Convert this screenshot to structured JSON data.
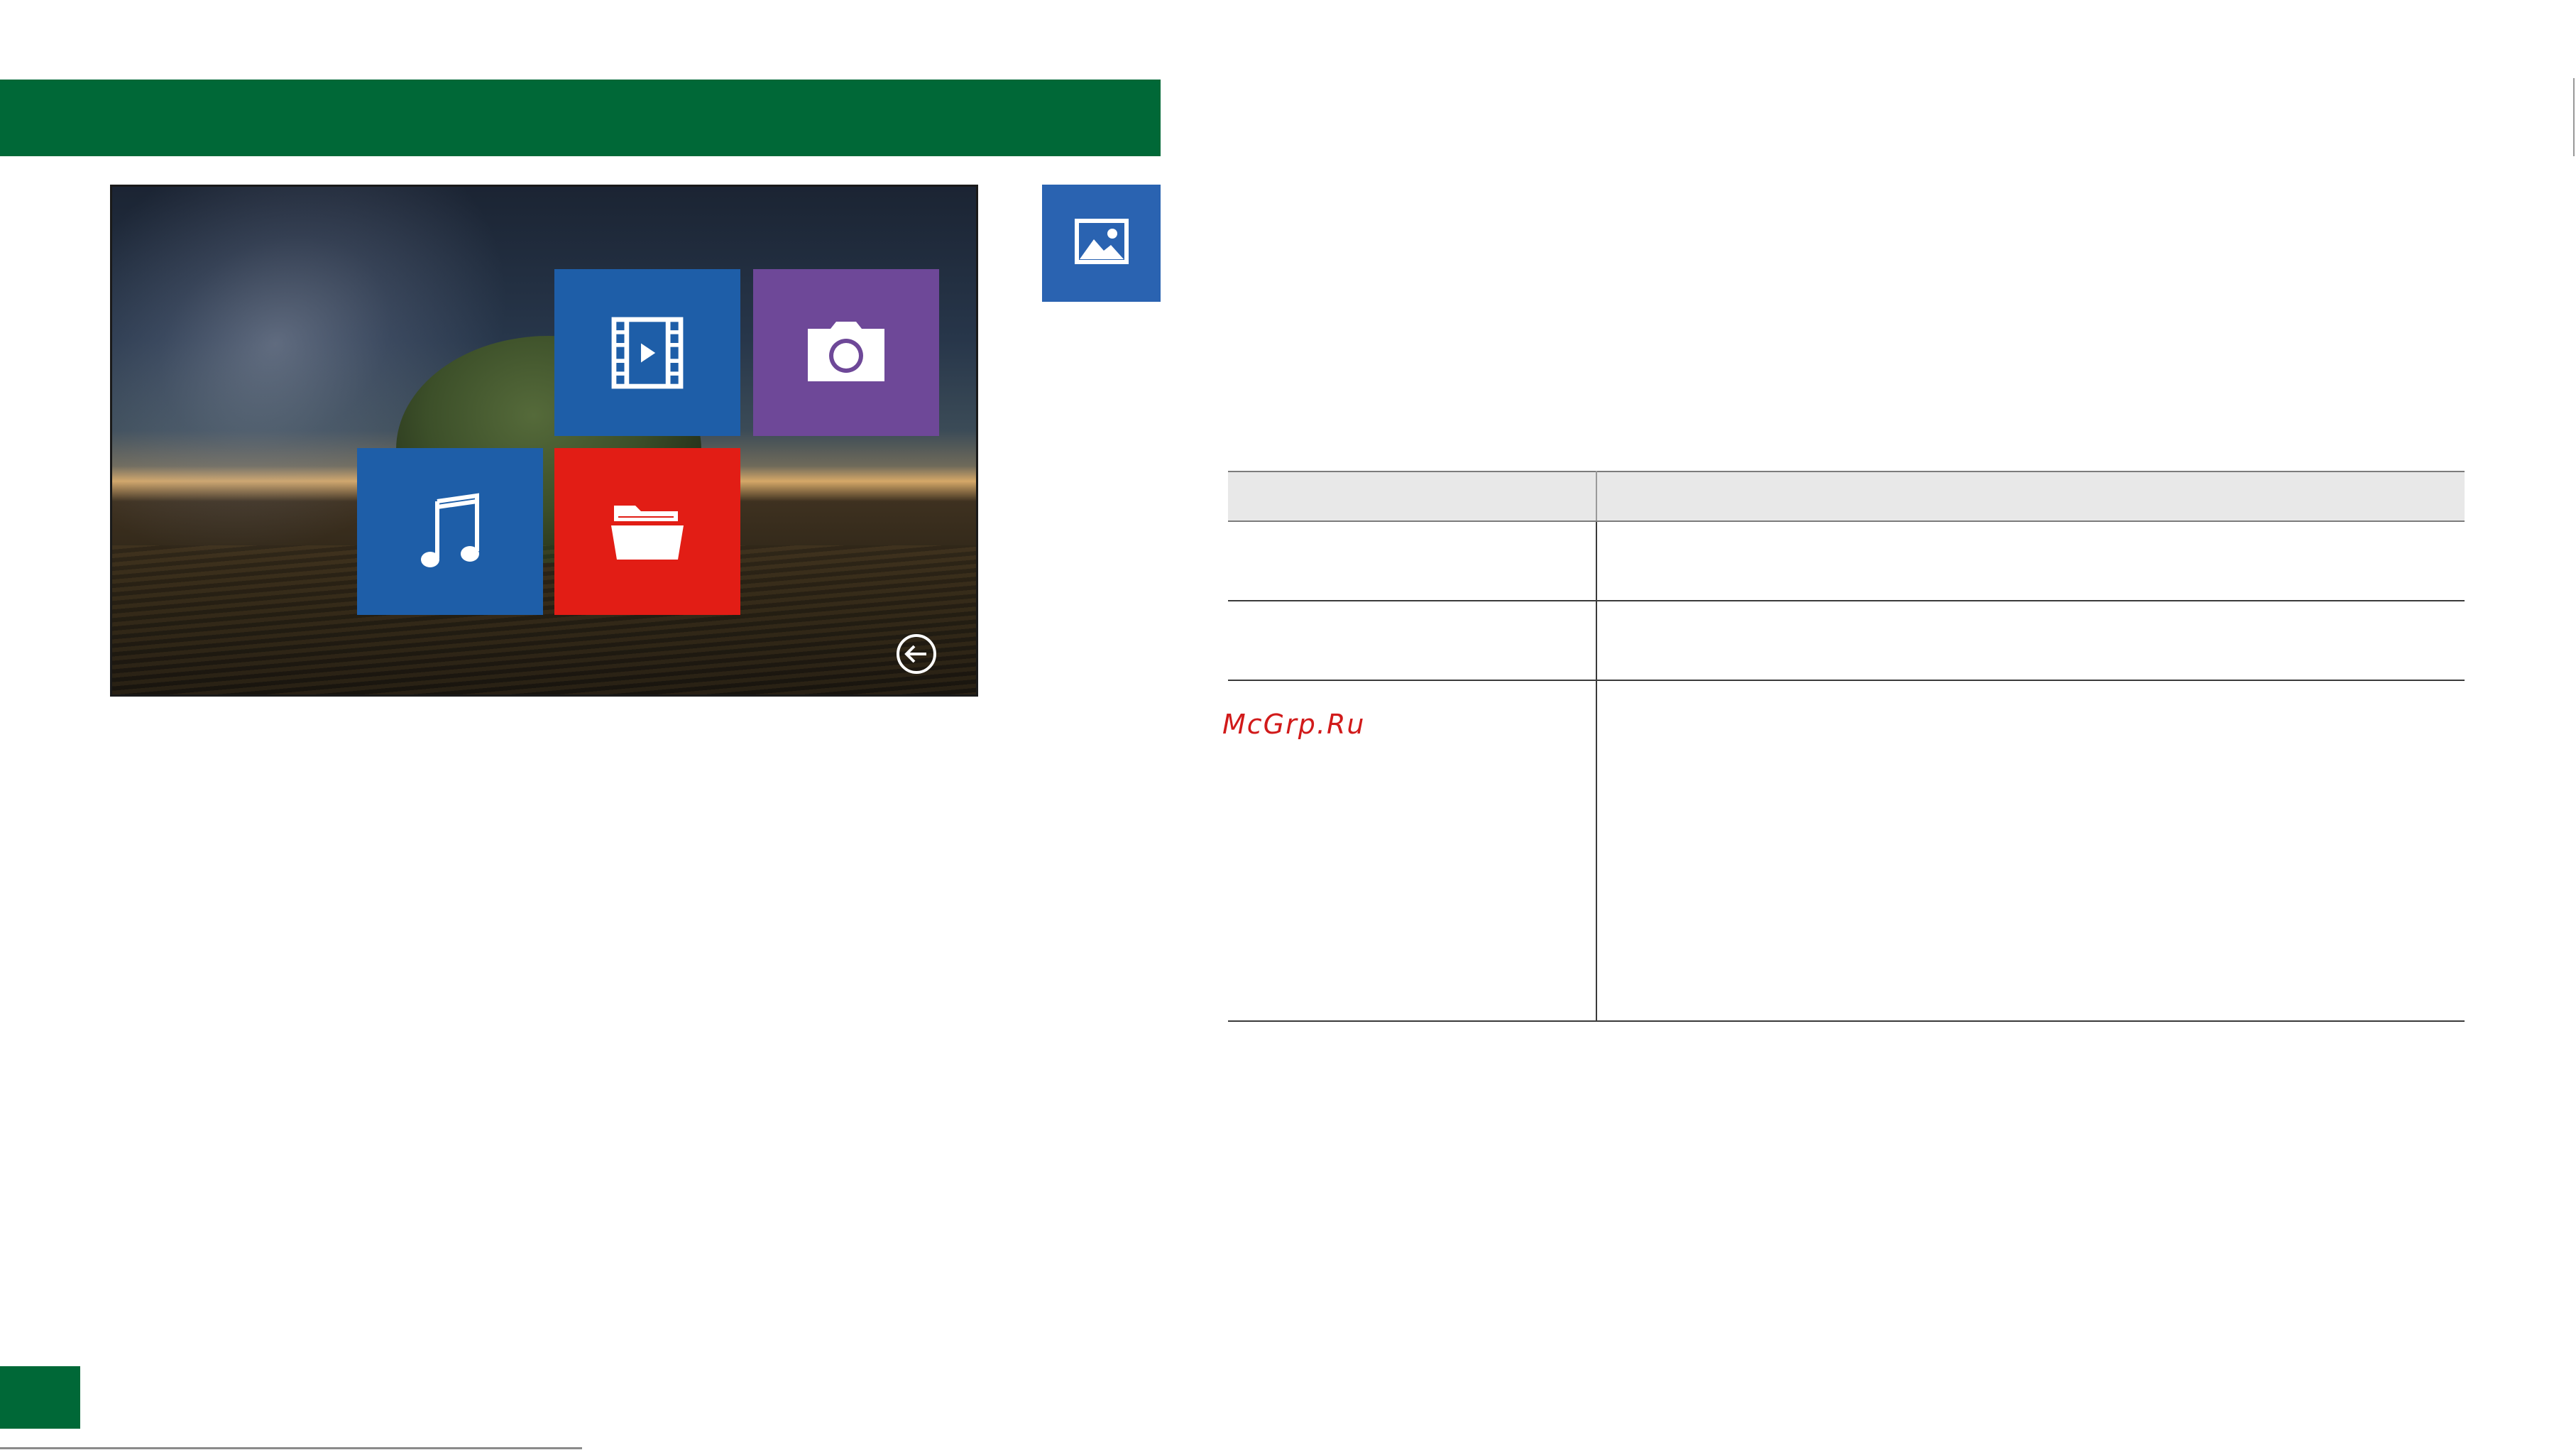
{
  "colors": {
    "header_green": "#006837",
    "video_tile": "#1e5ea8",
    "camera_tile": "#6e4898",
    "music_tile": "#1e5ea8",
    "folder_tile": "#e21d15",
    "side_icon": "#2a63b1",
    "table_header_bg": "#e8e8e8",
    "watermark": "#d11a1a"
  },
  "screen": {
    "tiles": [
      {
        "id": "video",
        "icon": "video-film-icon"
      },
      {
        "id": "camera",
        "icon": "camera-icon"
      },
      {
        "id": "music",
        "icon": "music-note-icon"
      },
      {
        "id": "folder",
        "icon": "folder-open-icon"
      }
    ],
    "back_icon": "back-arrow-circle-icon"
  },
  "side_icon": "image-gallery-icon",
  "watermark": "McGrp.Ru",
  "table": {
    "header": [
      "",
      ""
    ],
    "rows": [
      [
        "",
        ""
      ],
      [
        "",
        ""
      ],
      [
        "",
        ""
      ]
    ]
  }
}
